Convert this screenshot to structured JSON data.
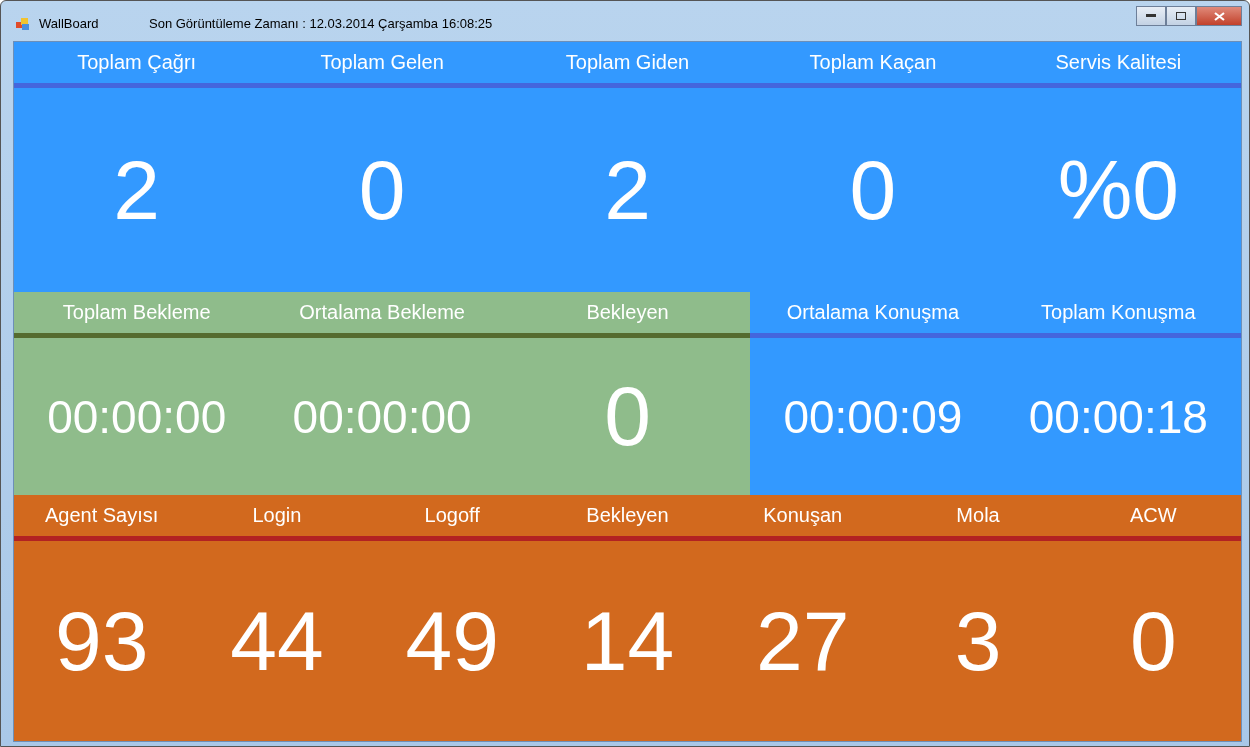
{
  "window": {
    "title": "WallBoard",
    "subtitle": "Son  Görüntüleme Zamanı : 12.03.2014 Çarşamba 16:08:25"
  },
  "rows": [
    {
      "panels": [
        {
          "color": "#3399ff",
          "items": [
            {
              "label": "Toplam Çağrı",
              "value": "2",
              "kind": "count"
            },
            {
              "label": "Toplam Gelen",
              "value": "0",
              "kind": "count"
            },
            {
              "label": "Toplam Giden",
              "value": "2",
              "kind": "count"
            },
            {
              "label": "Toplam Kaçan",
              "value": "0",
              "kind": "count"
            },
            {
              "label": "Servis Kalitesi",
              "value": "%0",
              "kind": "count"
            }
          ]
        }
      ]
    },
    {
      "panels": [
        {
          "color": "#8fbc8b",
          "items": [
            {
              "label": "Toplam Bekleme",
              "value": "00:00:00",
              "kind": "time"
            },
            {
              "label": "Ortalama Bekleme",
              "value": "00:00:00",
              "kind": "time"
            },
            {
              "label": "Bekleyen",
              "value": "0",
              "kind": "count"
            }
          ]
        },
        {
          "color": "#3399ff",
          "items": [
            {
              "label": "Ortalama Konuşma",
              "value": "00:00:09",
              "kind": "time"
            },
            {
              "label": "Toplam Konuşma",
              "value": "00:00:18",
              "kind": "time"
            }
          ]
        }
      ]
    },
    {
      "panels": [
        {
          "color": "#d2691e",
          "items": [
            {
              "label": "Agent Sayısı",
              "value": "93",
              "kind": "count"
            },
            {
              "label": "Login",
              "value": "44",
              "kind": "count"
            },
            {
              "label": "Logoff",
              "value": "49",
              "kind": "count"
            },
            {
              "label": "Bekleyen",
              "value": "14",
              "kind": "count"
            },
            {
              "label": "Konuşan",
              "value": "27",
              "kind": "count"
            },
            {
              "label": "Mola",
              "value": "3",
              "kind": "count"
            },
            {
              "label": "ACW",
              "value": "0",
              "kind": "count"
            }
          ]
        }
      ]
    }
  ]
}
